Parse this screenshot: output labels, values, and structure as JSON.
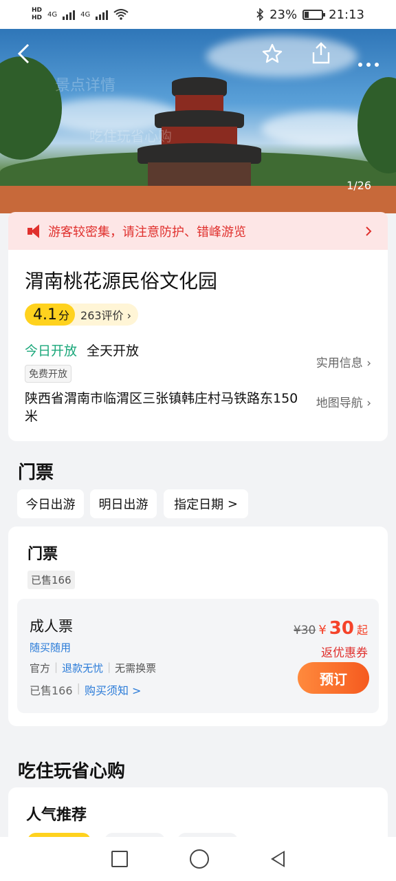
{
  "status_bar": {
    "battery": "23%",
    "time": "21:13",
    "net_labels": [
      "HD",
      "HD",
      "4G",
      "4G"
    ],
    "battery_level": 0.23
  },
  "hero": {
    "ghost_title": "景点详情",
    "ghost_sub": "吃住玩省心购",
    "counter": "1/26"
  },
  "alert": {
    "text": "游客较密集，请注意防护、错峰游览",
    "chevron": ">"
  },
  "poi": {
    "title": "渭南桃花源民俗文化园",
    "score": "4.1",
    "score_unit": "分",
    "reviews": "263评价",
    "open_today": "今日开放",
    "open_hours": "全天开放",
    "practical_info": "实用信息",
    "free_tag": "免费开放",
    "address": "陕西省渭南市临渭区三张镇韩庄村马铁路东150米",
    "map_nav": "地图导航"
  },
  "tickets_section": {
    "title": "门票",
    "date_options": [
      "今日出游",
      "明日出游",
      "指定日期"
    ],
    "chevron": ">"
  },
  "ticket_card": {
    "title": "门票",
    "sold": "已售166",
    "item": {
      "name": "成人票",
      "flex": "随买随用",
      "features": [
        "官方",
        "退款无忧",
        "无需换票"
      ],
      "sold": "已售166",
      "notice": "购买须知 >",
      "orig_price": "¥30",
      "cur_symbol": "¥",
      "cur_price": "30",
      "price_suffix": "起",
      "coupon": "返优惠券",
      "book": "预订"
    }
  },
  "eat_section": {
    "title": "吃住玩省心购",
    "rec_title": "人气推荐"
  },
  "colors": {
    "accent_orange": "#f55a1f",
    "price_red": "#f5432a",
    "open_green": "#1aa77a",
    "link_blue": "#2a7bd8",
    "score_yellow": "#ffd21e"
  },
  "icons": [
    "back-arrow-icon",
    "star-icon",
    "share-icon",
    "more-icon",
    "speaker-icon"
  ]
}
